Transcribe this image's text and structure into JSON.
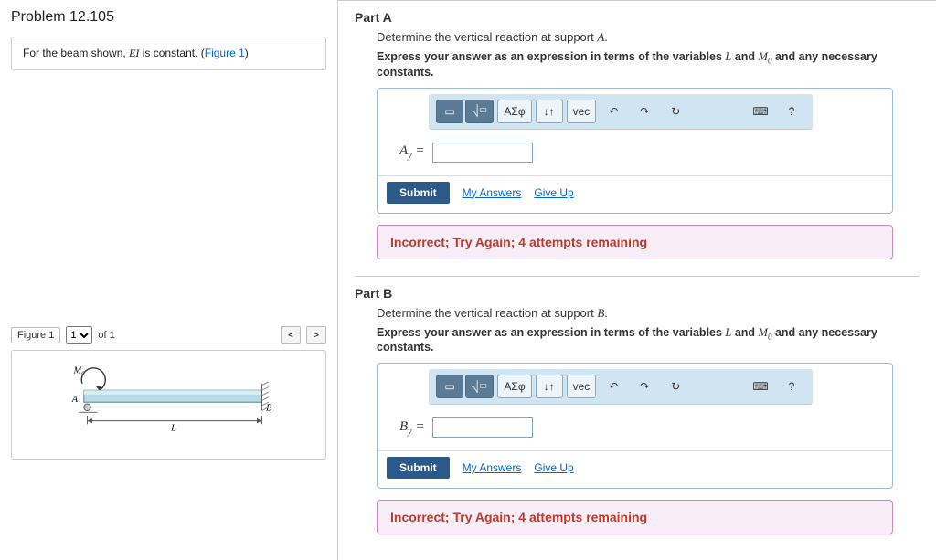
{
  "problem": {
    "title": "Problem 12.105",
    "description_prefix": "For the beam shown, ",
    "description_var": "EI",
    "description_suffix": " is constant. (",
    "figure_link": "Figure 1",
    "description_end": ")"
  },
  "figure": {
    "label": "Figure 1",
    "selector_value": "1",
    "of_text": "of 1",
    "prev": "<",
    "next": ">",
    "labels": {
      "M0": "M₀",
      "A": "A",
      "B": "B",
      "L": "L"
    }
  },
  "partA": {
    "label": "Part A",
    "desc_prefix": "Determine the vertical reaction at support ",
    "desc_var": "A",
    "desc_suffix": ".",
    "instr_prefix": "Express your answer as an expression in terms of the variables ",
    "instr_var1": "L",
    "instr_mid": " and ",
    "instr_var2": "M",
    "instr_var2_sub": "0",
    "instr_suffix": " and any necessary constants.",
    "result_var": "A",
    "result_sub": "y",
    "equals": " = ",
    "submit": "Submit",
    "my_answers": "My Answers",
    "give_up": "Give Up",
    "feedback": "Incorrect; Try Again; 4 attempts remaining"
  },
  "partB": {
    "label": "Part B",
    "desc_prefix": "Determine the vertical reaction at support ",
    "desc_var": "B",
    "desc_suffix": ".",
    "instr_prefix": "Express your answer as an expression in terms of the variables ",
    "instr_var1": "L",
    "instr_mid": " and ",
    "instr_var2": "M",
    "instr_var2_sub": "0",
    "instr_suffix": " and any necessary constants.",
    "result_var": "B",
    "result_sub": "y",
    "equals": " = ",
    "submit": "Submit",
    "my_answers": "My Answers",
    "give_up": "Give Up",
    "feedback": "Incorrect; Try Again; 4 attempts remaining"
  },
  "toolbar": {
    "template": "▭",
    "fraction": "⎷▭",
    "greek": "ΑΣφ",
    "updown": "↓↑",
    "vec": "vec",
    "undo": "↶",
    "redo": "↷",
    "reset": "↻",
    "keyboard": "⌨",
    "help": "?"
  }
}
